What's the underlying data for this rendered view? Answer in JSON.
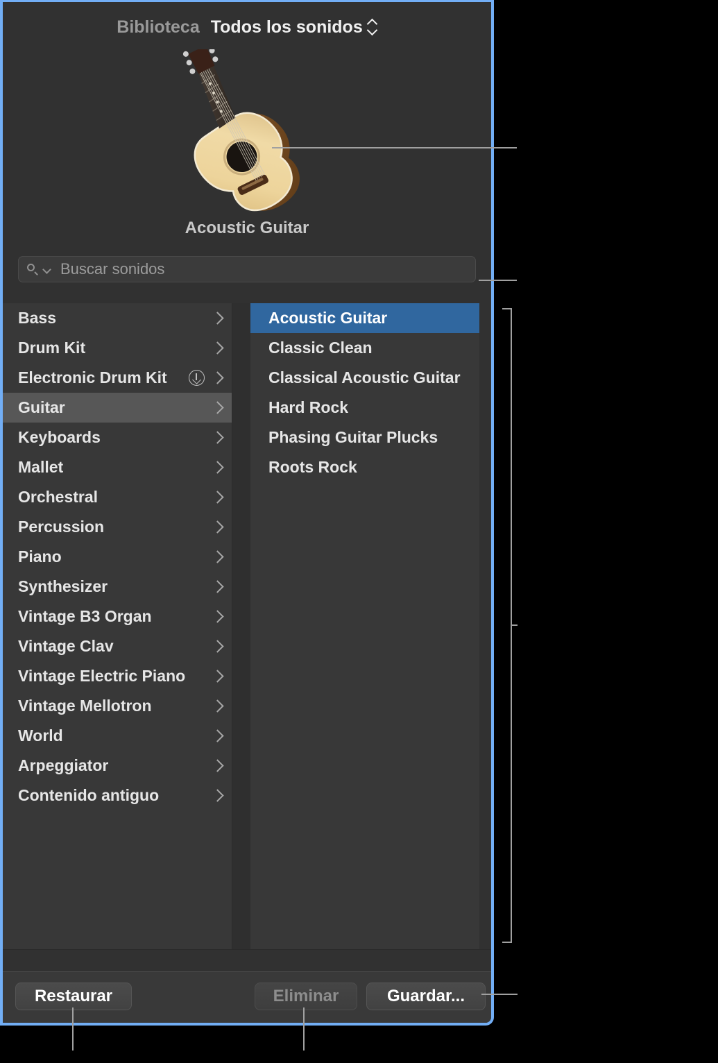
{
  "window": {
    "title": "Biblioteca",
    "focus_border_color": "#72aef5",
    "background_color": "#313131"
  },
  "header": {
    "library_label": "Biblioteca",
    "filter_label": "Todos los sonidos",
    "filter_icon": "updown-chevron-icon"
  },
  "preview": {
    "instrument_image": "acoustic-guitar-image",
    "name": "Acoustic Guitar"
  },
  "search": {
    "placeholder": "Buscar sonidos",
    "value": "",
    "search_icon": "search-icon",
    "dropdown_icon": "chevron-down-icon"
  },
  "categories": {
    "selected": "Guitar",
    "items": [
      {
        "label": "Bass",
        "has_download": false
      },
      {
        "label": "Drum Kit",
        "has_download": false
      },
      {
        "label": "Electronic Drum Kit",
        "has_download": true
      },
      {
        "label": "Guitar",
        "has_download": false
      },
      {
        "label": "Keyboards",
        "has_download": false
      },
      {
        "label": "Mallet",
        "has_download": false
      },
      {
        "label": "Orchestral",
        "has_download": false
      },
      {
        "label": "Percussion",
        "has_download": false
      },
      {
        "label": "Piano",
        "has_download": false
      },
      {
        "label": "Synthesizer",
        "has_download": false
      },
      {
        "label": "Vintage B3 Organ",
        "has_download": false
      },
      {
        "label": "Vintage Clav",
        "has_download": false
      },
      {
        "label": "Vintage Electric Piano",
        "has_download": false
      },
      {
        "label": "Vintage Mellotron",
        "has_download": false
      },
      {
        "label": "World",
        "has_download": false
      },
      {
        "label": "Arpeggiator",
        "has_download": false
      },
      {
        "label": "Contenido antiguo",
        "has_download": false
      }
    ]
  },
  "patches": {
    "selected": "Acoustic Guitar",
    "selected_color": "#30679f",
    "items": [
      {
        "label": "Acoustic Guitar"
      },
      {
        "label": "Classic Clean"
      },
      {
        "label": "Classical Acoustic Guitar"
      },
      {
        "label": "Hard Rock"
      },
      {
        "label": "Phasing Guitar Plucks"
      },
      {
        "label": "Roots Rock"
      }
    ]
  },
  "footer": {
    "restore_label": "Restaurar",
    "delete_label": "Eliminar",
    "save_label": "Guardar...",
    "delete_enabled": false
  }
}
